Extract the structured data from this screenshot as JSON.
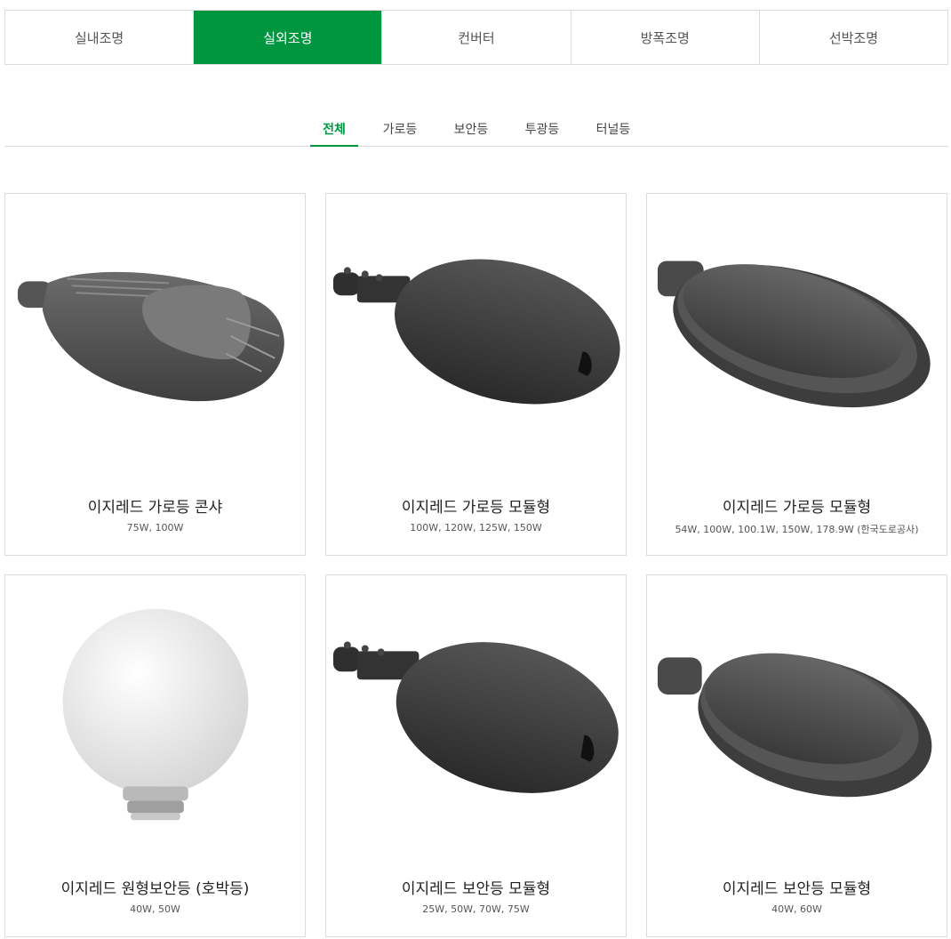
{
  "main_tabs": [
    "실내조명",
    "실외조명",
    "컨버터",
    "방폭조명",
    "선박조명"
  ],
  "main_tab_active": "실외조명",
  "sub_tabs": [
    "전체",
    "가로등",
    "보안등",
    "투광등",
    "터널등"
  ],
  "sub_tab_active": "전체",
  "accent_color": "#00963f",
  "products": [
    {
      "title": "이지레드 가로등 콘샤",
      "spec": "75W, 100W",
      "icon": "cobra-street-light-icon"
    },
    {
      "title": "이지레드 가로등 모듈형",
      "spec": "100W, 120W, 125W, 150W",
      "icon": "oval-street-light-icon"
    },
    {
      "title": "이지레드 가로등 모듈형",
      "spec": "54W, 100W, 100.1W, 150W, 178.9W (한국도로공사)",
      "icon": "dome-street-light-icon"
    },
    {
      "title": "이지레드 원형보안등 (호박등)",
      "spec": "40W, 50W",
      "icon": "globe-light-icon"
    },
    {
      "title": "이지레드 보안등 모듈형",
      "spec": "25W, 50W, 70W, 75W",
      "icon": "oval-security-light-icon"
    },
    {
      "title": "이지레드 보안등 모듈형",
      "spec": "40W, 60W",
      "icon": "dome-security-light-icon"
    }
  ]
}
